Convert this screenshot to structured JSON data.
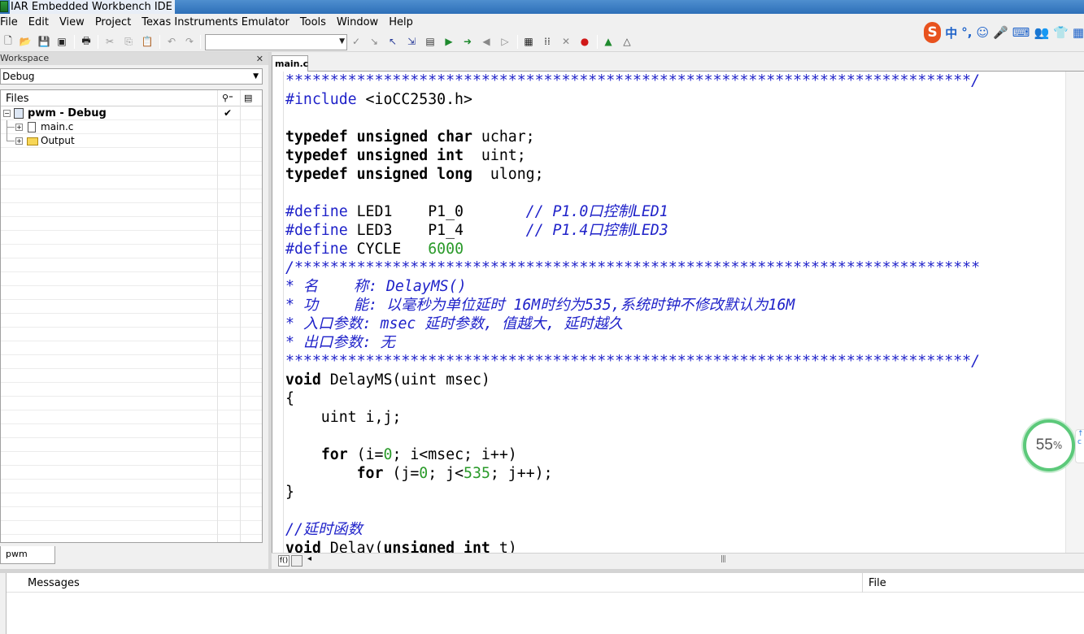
{
  "window": {
    "title": "IAR Embedded Workbench IDE"
  },
  "menu": [
    "File",
    "Edit",
    "View",
    "Project",
    "Texas Instruments Emulator",
    "Tools",
    "Window",
    "Help"
  ],
  "toolbar": {
    "icons": [
      "new-file-icon",
      "open-icon",
      "save-icon",
      "save-all-icon",
      "print-icon",
      "cut-icon",
      "copy-icon",
      "paste-icon",
      "undo-icon",
      "redo-icon",
      "find-combo",
      "toggle-bookmark-icon",
      "next-bookmark-icon",
      "go-to-icon",
      "navigate-back-icon",
      "navigate-forward-icon",
      "compile-icon",
      "make-icon",
      "stop-build-icon",
      "toggle-breakpoint-icon",
      "debug-icon",
      "debug-without-download-icon"
    ]
  },
  "ime": {
    "logo": "S",
    "items": [
      "中",
      "°,",
      "☺",
      "🎤",
      "⌨",
      "👥",
      "👕",
      "▦"
    ]
  },
  "workspace": {
    "header": "Workspace",
    "config": "Debug",
    "files_label": "Files",
    "tree": [
      {
        "label": "pwm - Debug",
        "bold": true,
        "checked": "✔"
      },
      {
        "label": "main.c"
      },
      {
        "label": "Output"
      }
    ],
    "tab": "pwm"
  },
  "editor": {
    "tab": "main.c",
    "code": [
      [
        {
          "c": "cm",
          "t": "*****************************************************************************/"
        }
      ],
      [
        {
          "c": "pp",
          "t": "#include"
        },
        {
          "c": "op",
          "t": " <ioCC2530.h>"
        }
      ],
      [
        {
          "c": "op",
          "t": ""
        }
      ],
      [
        {
          "c": "kw",
          "t": "typedef"
        },
        {
          "c": "op",
          "t": " "
        },
        {
          "c": "kw",
          "t": "unsigned"
        },
        {
          "c": "op",
          "t": " "
        },
        {
          "c": "kw",
          "t": "char"
        },
        {
          "c": "op",
          "t": " uchar;"
        }
      ],
      [
        {
          "c": "kw",
          "t": "typedef"
        },
        {
          "c": "op",
          "t": " "
        },
        {
          "c": "kw",
          "t": "unsigned"
        },
        {
          "c": "op",
          "t": " "
        },
        {
          "c": "kw",
          "t": "int"
        },
        {
          "c": "op",
          "t": "  uint;"
        }
      ],
      [
        {
          "c": "kw",
          "t": "typedef"
        },
        {
          "c": "op",
          "t": " "
        },
        {
          "c": "kw",
          "t": "unsigned"
        },
        {
          "c": "op",
          "t": " "
        },
        {
          "c": "kw",
          "t": "long"
        },
        {
          "c": "op",
          "t": "  ulong;"
        }
      ],
      [
        {
          "c": "op",
          "t": ""
        }
      ],
      [
        {
          "c": "pp",
          "t": "#define"
        },
        {
          "c": "op",
          "t": " LED1    P1_0       "
        },
        {
          "c": "cm",
          "t": "// P1.0口控制LED1"
        }
      ],
      [
        {
          "c": "pp",
          "t": "#define"
        },
        {
          "c": "op",
          "t": " LED3    P1_4       "
        },
        {
          "c": "cm",
          "t": "// P1.4口控制LED3"
        }
      ],
      [
        {
          "c": "pp",
          "t": "#define"
        },
        {
          "c": "op",
          "t": " CYCLE   "
        },
        {
          "c": "num",
          "t": "6000"
        }
      ],
      [
        {
          "c": "cm",
          "t": "/*****************************************************************************"
        }
      ],
      [
        {
          "c": "cm",
          "t": "* 名    称: DelayMS()"
        }
      ],
      [
        {
          "c": "cm",
          "t": "* 功    能: 以毫秒为单位延时 16M时约为535,系统时钟不修改默认为16M"
        }
      ],
      [
        {
          "c": "cm",
          "t": "* 入口参数: msec 延时参数, 值越大, 延时越久"
        }
      ],
      [
        {
          "c": "cm",
          "t": "* 出口参数: 无"
        }
      ],
      [
        {
          "c": "cm",
          "t": "*****************************************************************************/"
        }
      ],
      [
        {
          "c": "kw",
          "t": "void"
        },
        {
          "c": "op",
          "t": " DelayMS(uint msec)"
        }
      ],
      [
        {
          "c": "op",
          "t": "{"
        }
      ],
      [
        {
          "c": "op",
          "t": "    uint i,j;"
        }
      ],
      [
        {
          "c": "op",
          "t": ""
        }
      ],
      [
        {
          "c": "op",
          "t": "    "
        },
        {
          "c": "kw",
          "t": "for"
        },
        {
          "c": "op",
          "t": " (i="
        },
        {
          "c": "num",
          "t": "0"
        },
        {
          "c": "op",
          "t": "; i<msec; i++)"
        }
      ],
      [
        {
          "c": "op",
          "t": "        "
        },
        {
          "c": "kw",
          "t": "for"
        },
        {
          "c": "op",
          "t": " (j="
        },
        {
          "c": "num",
          "t": "0"
        },
        {
          "c": "op",
          "t": "; j<"
        },
        {
          "c": "num",
          "t": "535"
        },
        {
          "c": "op",
          "t": "; j++);"
        }
      ],
      [
        {
          "c": "op",
          "t": "}"
        }
      ],
      [
        {
          "c": "op",
          "t": ""
        }
      ],
      [
        {
          "c": "cm",
          "t": "//延时函数"
        }
      ],
      [
        {
          "c": "kw",
          "t": "void"
        },
        {
          "c": "op",
          "t": " Delay("
        },
        {
          "c": "kw",
          "t": "unsigned"
        },
        {
          "c": "op",
          "t": " "
        },
        {
          "c": "kw",
          "t": "int"
        },
        {
          "c": "op",
          "t": " t)"
        }
      ]
    ],
    "hscroll_label": "f()"
  },
  "progress": {
    "value": "55",
    "unit": "%"
  },
  "messages": {
    "col_messages": "Messages",
    "col_file": "File"
  }
}
